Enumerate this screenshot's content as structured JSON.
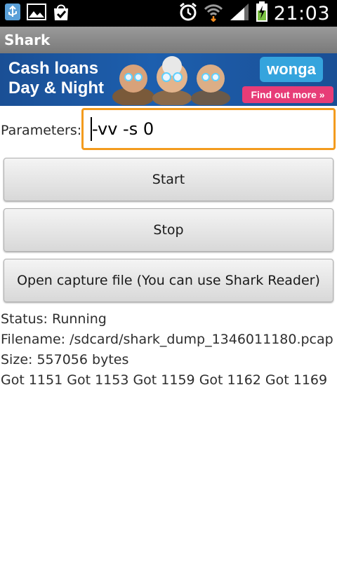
{
  "status_bar": {
    "time": "21:03",
    "left_icons": [
      "usb-icon",
      "gallery-icon",
      "shopping-bag-icon"
    ],
    "right_icons": [
      "alarm-icon",
      "wifi-icon",
      "signal-icon",
      "battery-charging-icon"
    ]
  },
  "app": {
    "title": "Shark"
  },
  "ad": {
    "line1": "Cash loans",
    "line2": "Day & Night",
    "brand": "wonga",
    "cta": "Find out more »"
  },
  "form": {
    "parameters_label": "Parameters:",
    "parameters_value": "-vv -s 0"
  },
  "buttons": {
    "start": "Start",
    "stop": "Stop",
    "open_capture": "Open capture file (You can use Shark Reader)"
  },
  "info": {
    "status": "Status: Running",
    "filename": "Filename: /sdcard/shark_dump_1346011180.pcap",
    "size": "Size: 557056 bytes",
    "log": "Got 1151 Got 1153 Got 1159 Got 1162 Got 1169"
  },
  "colors": {
    "statusbar": "#000000",
    "titlebar": "#8a8a8a",
    "input_focus": "#f39b1e",
    "ad_background": "#1d5fae",
    "ad_cta": "#e73c77"
  }
}
